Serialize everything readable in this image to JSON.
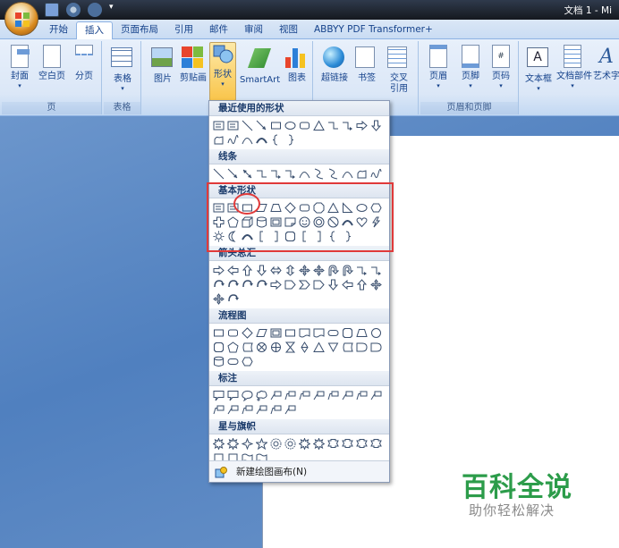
{
  "window": {
    "title": "文档 1 - Mi"
  },
  "tabs": [
    "开始",
    "插入",
    "页面布局",
    "引用",
    "邮件",
    "审阅",
    "视图",
    "ABBYY PDF Transformer+"
  ],
  "ribbon": {
    "page_group": {
      "label": "页",
      "buttons": [
        "封面",
        "空白页",
        "分页"
      ]
    },
    "table_group": {
      "label": "表格",
      "buttons": [
        "表格"
      ]
    },
    "illustrations": {
      "buttons": [
        "图片",
        "剪贴画",
        "形状",
        "SmartArt",
        "图表"
      ]
    },
    "links": {
      "buttons": [
        "超链接",
        "书签",
        "交叉",
        "引用"
      ]
    },
    "header_footer": {
      "label": "页眉和页脚",
      "buttons": [
        "页眉",
        "页脚",
        "页码"
      ]
    },
    "text": {
      "buttons": [
        "文本框",
        "文档部件",
        "艺术字"
      ]
    }
  },
  "shapes_menu": {
    "sections": [
      "最近使用的形状",
      "线条",
      "基本形状",
      "箭头总汇",
      "流程图",
      "标注",
      "星与旗帜"
    ],
    "new_canvas": "新建绘图画布(N)"
  },
  "watermark": {
    "title": "百科全说",
    "subtitle": "助你轻松解决"
  },
  "colors": {
    "accent": "#f9c54b",
    "highlight": "#e03a3a",
    "ribbon_text": "#15428b"
  }
}
